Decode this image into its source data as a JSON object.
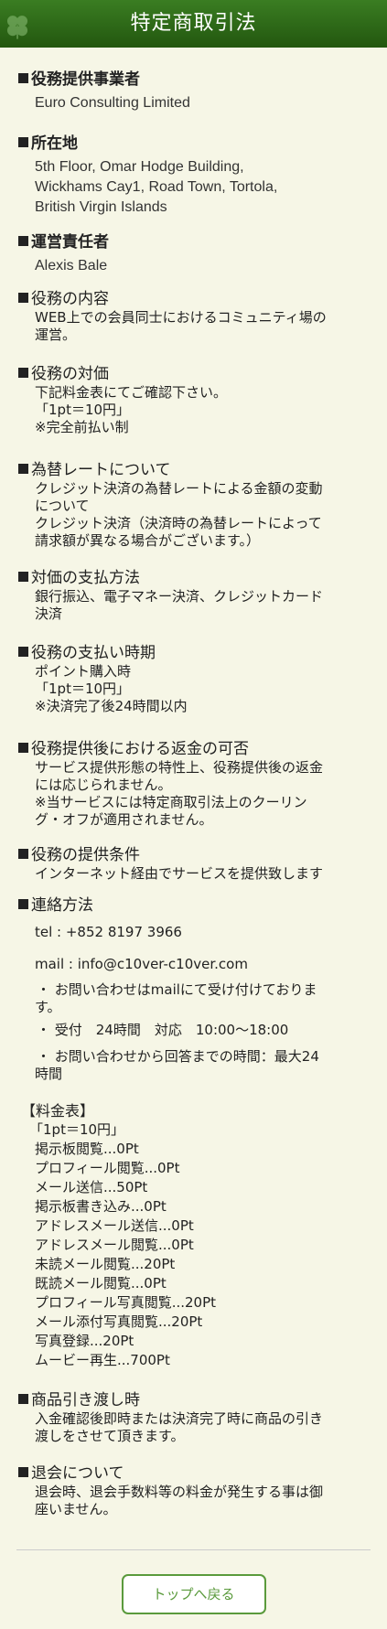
{
  "header": {
    "title": "特定商取引法"
  },
  "sections": {
    "provider": {
      "title": "役務提供事業者",
      "lines": [
        "Euro Consulting Limited"
      ]
    },
    "address": {
      "title": "所在地",
      "lines": [
        "5th Floor, Omar Hodge Building,",
        "Wickhams Cay1, Road Town, Tortola,",
        "British Virgin Islands"
      ]
    },
    "manager": {
      "title": "運営責任者",
      "lines": [
        "Alexis Bale"
      ]
    },
    "content": {
      "title": "役務の内容",
      "lines": [
        "WEB上での会員同士におけるコミュニティ場の",
        "運営。"
      ]
    },
    "price": {
      "title": "役務の対価",
      "lines": [
        "下記料金表にてご確認下さい。",
        "「1pt＝10円」",
        "※完全前払い制"
      ]
    },
    "exchange": {
      "title": "為替レートについて",
      "lines": [
        "クレジット決済の為替レートによる金額の変動",
        "について",
        "クレジット決済（決済時の為替レートによって",
        "請求額が異なる場合がございます。）"
      ]
    },
    "payment_method": {
      "title": "対価の支払方法",
      "lines": [
        "銀行振込、電子マネー決済、クレジットカード",
        "決済"
      ]
    },
    "payment_time": {
      "title": "役務の支払い時期",
      "lines": [
        "ポイント購入時",
        "「1pt＝10円」",
        "※決済完了後24時間以内"
      ]
    },
    "refund": {
      "title": "役務提供後における返金の可否",
      "lines": [
        "サービス提供形態の特性上、役務提供後の返金",
        "には応じられません。",
        "※当サービスには特定商取引法上のクーリン",
        "グ・オフが適用されません。"
      ]
    },
    "conditions": {
      "title": "役務の提供条件",
      "lines": [
        "インターネット経由でサービスを提供致します"
      ]
    },
    "contact": {
      "title": "連絡方法",
      "tel": "tel : +852 8197 3966",
      "mail": "mail : info@c10ver-c10ver.com",
      "bullets": [
        "・ お問い合わせはmailにて受け付けておりま",
        "す。",
        "・ 受付　24時間　対応　10:00～18:00",
        "・ お問い合わせから回答までの時間：最大24",
        "時間"
      ]
    },
    "price_table": {
      "title": "【料金表】",
      "rate": "「1pt＝10円」",
      "items": [
        "掲示板閲覧...0Pt",
        "プロフィール閲覧...0Pt",
        "メール送信...50Pt",
        "掲示板書き込み...0Pt",
        "アドレスメール送信...0Pt",
        "アドレスメール閲覧...0Pt",
        "未読メール閲覧...20Pt",
        "既読メール閲覧...0Pt",
        "プロフィール写真閲覧...20Pt",
        "メール添付写真閲覧...20Pt",
        "写真登録...20Pt",
        "ムービー再生...700Pt"
      ]
    },
    "delivery": {
      "title": "商品引き渡し時",
      "lines": [
        "入金確認後即時または決済完了時に商品の引き",
        "渡しをさせて頂きます。"
      ]
    },
    "withdrawal": {
      "title": "退会について",
      "lines": [
        "退会時、退会手数料等の料金が発生する事は御",
        "座いません。"
      ]
    }
  },
  "footer": {
    "back_button_label": "トップへ戻る"
  },
  "colors": {
    "header_bg": "#2d6b19",
    "page_bg": "#f6f6e6",
    "button_accent": "#5a9a3c"
  },
  "icons": {
    "header_logo": "clover-icon"
  }
}
